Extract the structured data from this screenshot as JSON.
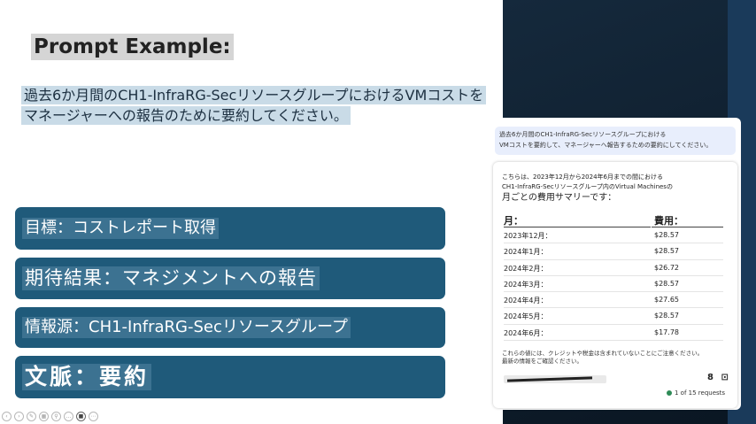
{
  "slide": {
    "title": "Prompt Example:",
    "prompt_lines": [
      "過去6か月間のCH1-InfraRG-SecリソースグループにおけるVMコストを",
      "マネージャーへの報告のために要約してください。"
    ],
    "cards": [
      "目標：コストレポート取得",
      "期待結果：マネジメントへの報告",
      "情報源：CH1-InfraRG-Secリソースグループ",
      "文脈：要約"
    ]
  },
  "chat": {
    "user_bubble": [
      "過去6か月間のCH1-InfraRG-Secリソースグループにおける",
      "VMコストを要約して、マネージャーへ報告するための要約にしてください。"
    ],
    "response_intro": [
      "こちらは、2023年12月から2024年6月までの間における",
      "CH1-InfraRG-Secリソースグループ内のVirtual Machinesの"
    ],
    "response_intro_big": "月ごとの費用サマリーです：",
    "table": {
      "headers": [
        "月：",
        "費用："
      ],
      "rows": [
        [
          "2023年12月：",
          "$28.57"
        ],
        [
          "2024年1月：",
          "$28.57"
        ],
        [
          "2024年2月：",
          "$26.72"
        ],
        [
          "2024年3月：",
          "$28.57"
        ],
        [
          "2024年4月：",
          "$27.65"
        ],
        [
          "2024年5月：",
          "$28.57"
        ],
        [
          "2024年6月：",
          "$17.78"
        ]
      ]
    },
    "note": [
      "これらの値には、クレジットや税金は含まれていないことにご注意ください。",
      "最新の情報をご確認ください。"
    ],
    "requests": "1 of 15 requests",
    "status_color": "#2e8b57"
  },
  "icons": {
    "toolbar": [
      "prev-icon",
      "next-icon",
      "pen-icon",
      "grid-icon",
      "zoom-icon",
      "more-icon",
      "camera-icon",
      "menu-icon"
    ],
    "response": [
      "copy-icon",
      "feedback-icon"
    ]
  }
}
